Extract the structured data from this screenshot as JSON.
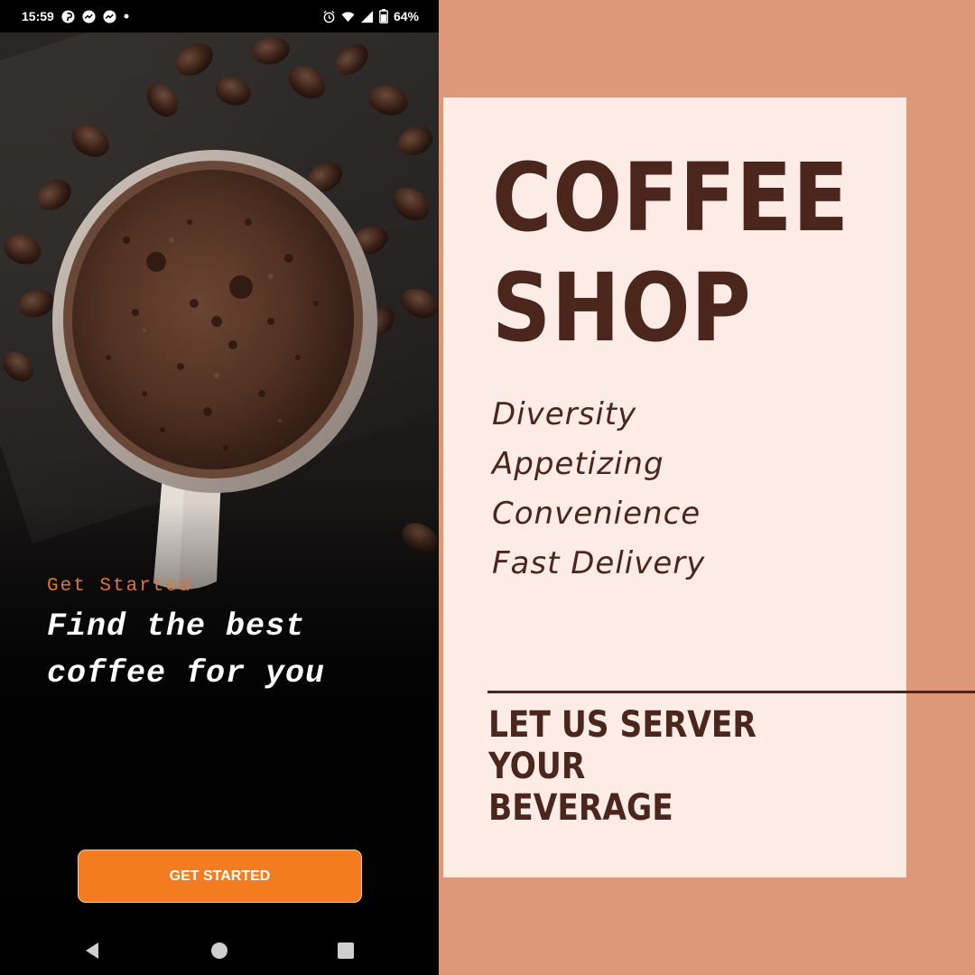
{
  "status_bar": {
    "time": "15:59",
    "left_icons": [
      "pinterest-icon",
      "messenger-icon",
      "messenger-icon",
      "dot-icon"
    ],
    "right_icons": [
      "alarm-icon",
      "wifi-icon",
      "signal-icon",
      "battery-icon"
    ],
    "battery": "64%"
  },
  "phone": {
    "label": "Get Started",
    "headline_line1": "Find the best",
    "headline_line2": "coffee for you",
    "button_label": "GET STARTED",
    "nav": [
      "back-icon",
      "home-icon",
      "recents-icon"
    ]
  },
  "poster": {
    "title_line1": "COFFEE",
    "title_line2": "SHOP",
    "features": [
      "Diversity",
      "Appetizing",
      "Convenience",
      "Fast Delivery"
    ],
    "tagline_line1": "LET US SERVER YOUR",
    "tagline_line2": "BEVERAGE"
  },
  "colors": {
    "background": "#dc9878",
    "card": "#fdece6",
    "text_brown": "#4b261d",
    "accent_orange": "#f47c20",
    "label_orange": "#e0733a"
  }
}
